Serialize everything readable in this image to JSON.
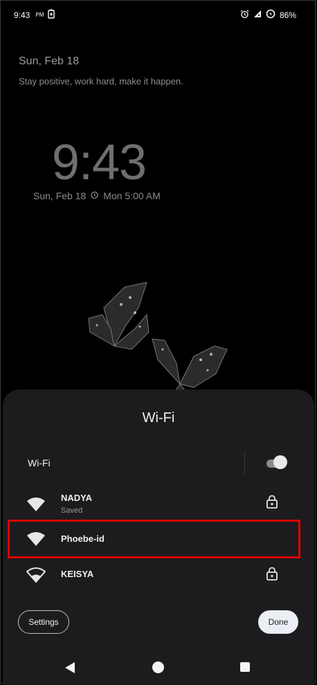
{
  "status_bar": {
    "time": "9:43",
    "ampm": "PM",
    "battery": "86%",
    "icons": [
      "battery-saver-icon",
      "alarm-icon",
      "signal-icon",
      "data-saver-icon"
    ]
  },
  "lockscreen": {
    "date": "Sun, Feb 18",
    "message": "Stay positive, work hard, make it happen.",
    "clock": "9:43",
    "clock_subtitle_date": "Sun, Feb 18",
    "alarm": "Mon 5:00 AM"
  },
  "sheet": {
    "title": "Wi-Fi",
    "wifi_toggle_label": "Wi-Fi",
    "wifi_enabled": true,
    "networks": [
      {
        "name": "NADYA",
        "status": "Saved",
        "secured": true
      },
      {
        "name": "Phoebe-id",
        "status": "",
        "secured": false
      },
      {
        "name": "KEISYA",
        "status": "",
        "secured": true
      }
    ],
    "settings_label": "Settings",
    "done_label": "Done"
  },
  "colors": {
    "highlight": "#e00000",
    "sheet_bg": "#1c1c1e"
  }
}
